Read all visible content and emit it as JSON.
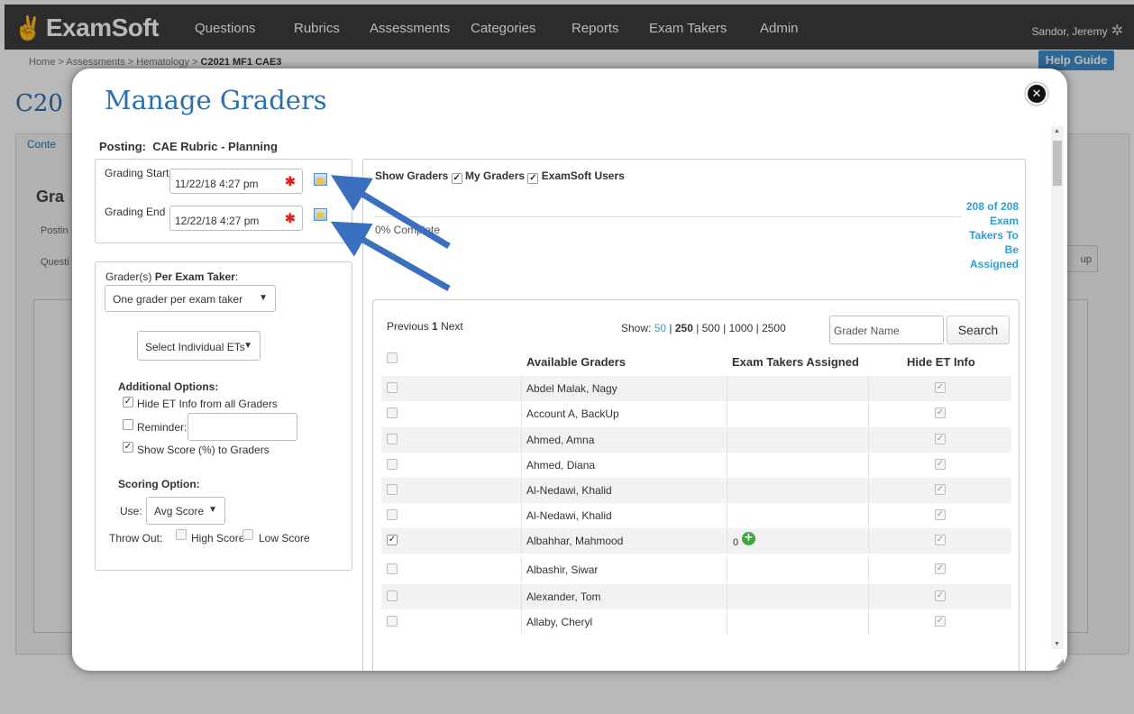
{
  "app": {
    "logo": "ExamSoft",
    "nav": [
      "Questions",
      "Rubrics",
      "Assessments",
      "Categories",
      "Reports",
      "Exam Takers",
      "Admin"
    ],
    "user": "Sandor, Jeremy",
    "help_guide": "Help Guide"
  },
  "breadcrumb": {
    "home": "Home",
    "assessments": "Assessments",
    "course": "Hematology",
    "current": "C2021 MF1 CAE3",
    "sep": ">"
  },
  "background": {
    "title": "C20",
    "tab": "Conte",
    "heading": "Gra",
    "posting": "Postin",
    "question": "Questi",
    "button": "up"
  },
  "modal": {
    "title": "Manage Graders",
    "close_icon": "close-icon",
    "posting_label": "Posting:",
    "posting_value": "CAE Rubric - Planning",
    "grading_start_label": "Grading Start",
    "grading_start_value": "11/22/18 4:27 pm",
    "grading_end_label": "Grading End",
    "grading_end_value": "12/22/18 4:27 pm",
    "required_mark": "✱",
    "graders_per_label_prefix": "Grader(s) ",
    "graders_per_label_bold": "Per Exam Taker",
    "graders_per_label_suffix": ":",
    "graders_per_value": "One grader per exam taker",
    "select_individual": "Select Individual ETs",
    "additional_options": "Additional Options:",
    "hide_et_info": "Hide ET Info from all Graders",
    "reminder": "Reminder:",
    "show_score": "Show Score (%) to Graders",
    "scoring_option": "Scoring Option:",
    "use_label": "Use:",
    "use_value": "Avg Score",
    "throw_out": "Throw Out:",
    "high_score": "High Score",
    "low_score": "Low Score",
    "show_graders": "Show Graders",
    "my_graders": "My Graders",
    "examsoft_users": "ExamSoft Users",
    "complete": "0% Complete",
    "to_be_assigned": [
      "208 of 208",
      "Exam",
      "Takers To",
      "Be",
      "Assigned"
    ],
    "pagination_prev": "Previous",
    "pagination_page": "1",
    "pagination_next": "Next",
    "show_label": "Show:",
    "show_50": "50",
    "show_250": "250",
    "show_500": "500",
    "show_1000": "1000",
    "show_2500": "2500",
    "pipe": "|",
    "search_placeholder": "Grader Name",
    "search_button": "Search",
    "col_available": "Available Graders",
    "col_assigned": "Exam Takers Assigned",
    "col_hide": "Hide ET Info"
  },
  "graders": [
    {
      "name": "Abdel Malak, Nagy",
      "checked": false,
      "assigned": ""
    },
    {
      "name": "Account A, BackUp",
      "checked": false,
      "assigned": ""
    },
    {
      "name": "Ahmed, Amna",
      "checked": false,
      "assigned": ""
    },
    {
      "name": "Ahmed, Diana",
      "checked": false,
      "assigned": ""
    },
    {
      "name": "Al-Nedawi, Khalid",
      "checked": false,
      "assigned": ""
    },
    {
      "name": "Al-Nedawi, Khalid",
      "checked": false,
      "assigned": ""
    },
    {
      "name": "Albahhar, Mahmood",
      "checked": true,
      "assigned": "0"
    },
    {
      "name": "Albashir, Siwar",
      "checked": false,
      "assigned": ""
    },
    {
      "name": "Alexander, Tom",
      "checked": false,
      "assigned": ""
    },
    {
      "name": "Allaby, Cheryl",
      "checked": false,
      "assigned": ""
    }
  ],
  "colors": {
    "nav_bg": "#3d3d3d",
    "title_blue": "#2a6fb0",
    "link_blue": "#2a9fd6",
    "arrow_blue": "#3b6fbf",
    "required_red": "#dd2222",
    "add_green": "#3ca83c"
  }
}
